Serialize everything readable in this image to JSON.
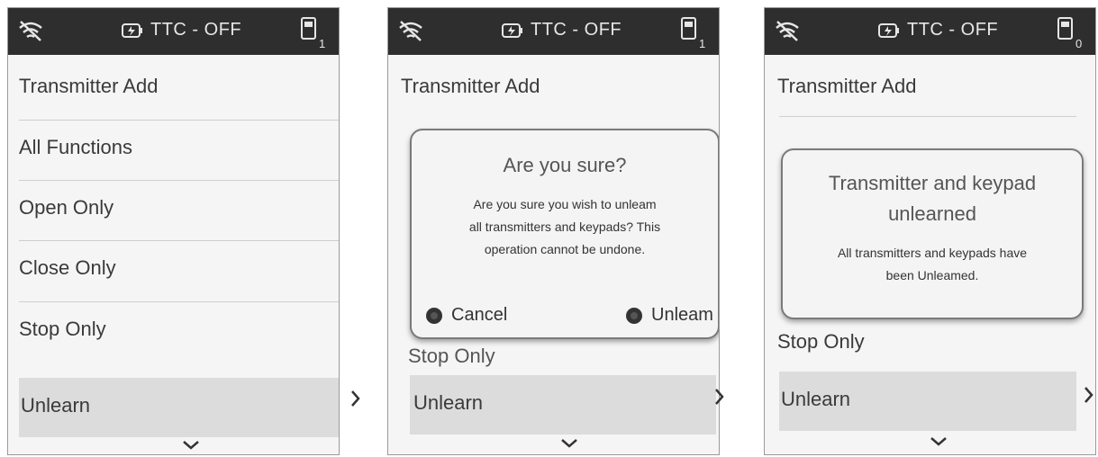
{
  "status_bar": {
    "wifi_icon": "wifi-off-icon",
    "battery_icon": "battery-charging-icon",
    "ttc_text": "TTC - OFF",
    "remote_icon": "remote-icon"
  },
  "screens": [
    {
      "remote_count": "1",
      "menu": [
        "Transmitter Add",
        "All Functions",
        "Open Only",
        "Close Only",
        "Stop Only",
        "Unlearn"
      ]
    },
    {
      "remote_count": "1",
      "menu": [
        "Transmitter Add",
        "Unlearn"
      ],
      "menu_partial": "Stop Only",
      "dialog": {
        "title": "Are you sure?",
        "line1": "Are you sure you wish to unleam",
        "line2": "all transmitters and keypads? This",
        "line3": "operation cannot be undone.",
        "cancel_label": "Cancel",
        "unlearn_label": "Unleam"
      }
    },
    {
      "remote_count": "0",
      "menu": [
        "Transmitter Add",
        "Stop Only",
        "Unlearn"
      ],
      "dialog": {
        "title_line1": "Transmitter and keypad",
        "title_line2": "unlearned",
        "body_line1": "All transmitters and keypads have",
        "body_line2": "been Unleamed."
      }
    }
  ],
  "colors": {
    "status_bar": "#2e2e2e",
    "background": "#f5f5f5",
    "selected_row": "#dcdcdc"
  }
}
